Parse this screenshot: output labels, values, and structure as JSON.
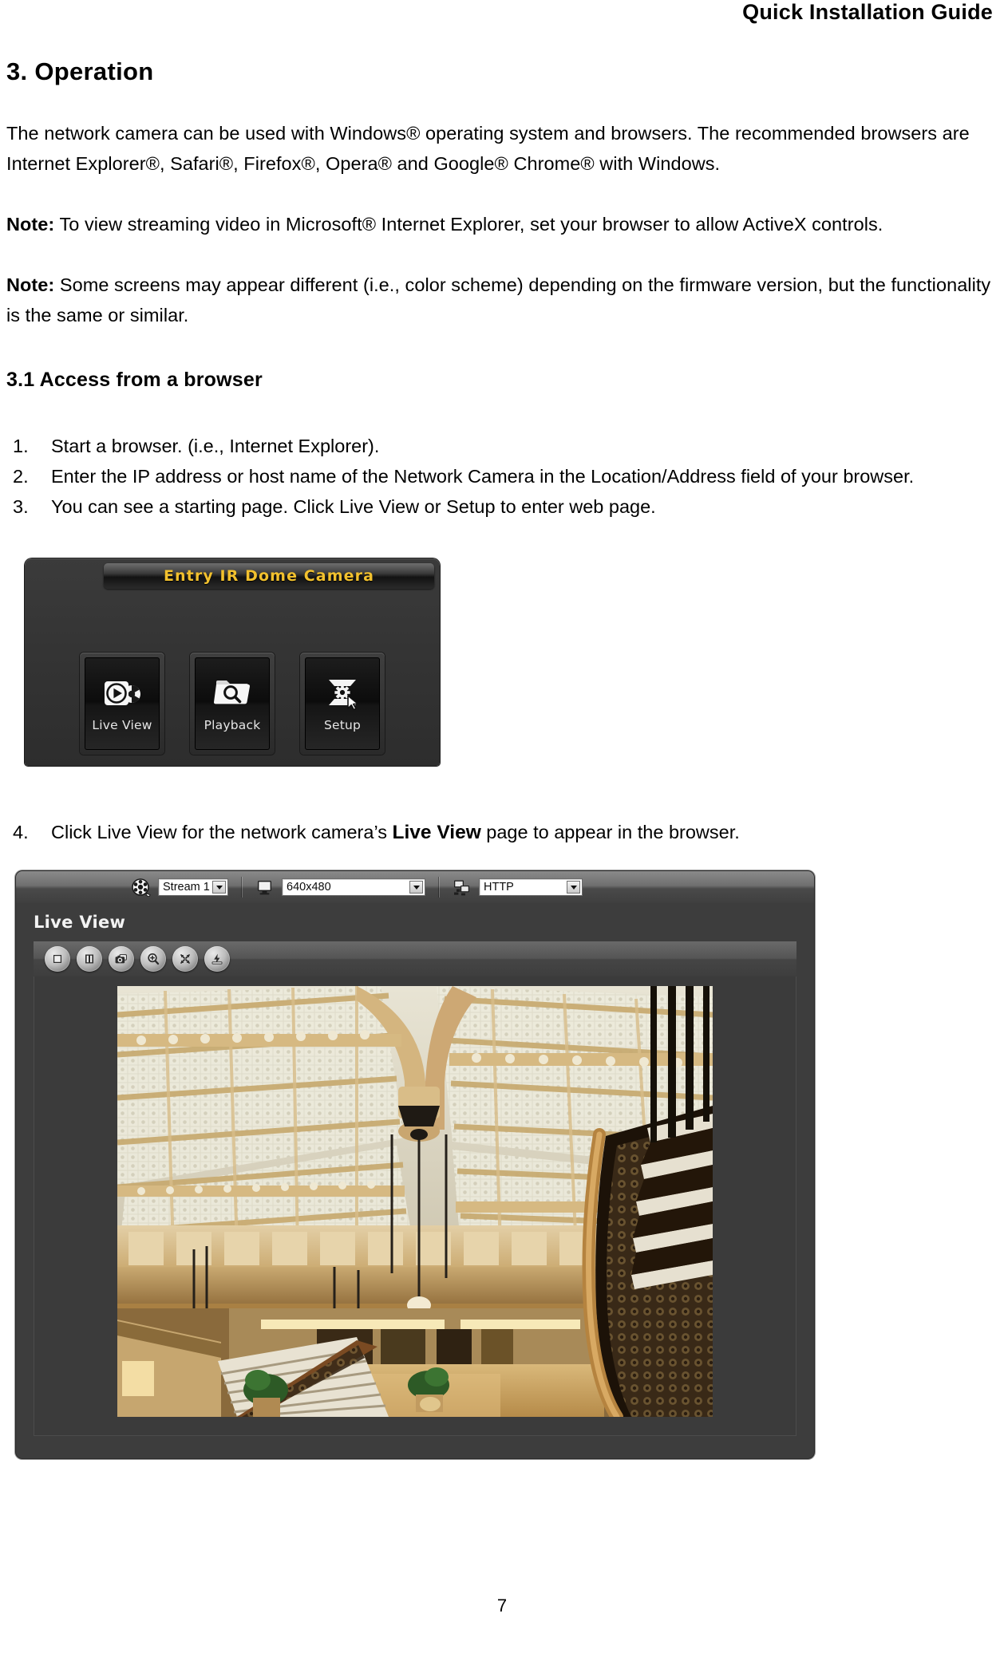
{
  "document": {
    "header_title": "Quick Installation Guide",
    "page_number": "7"
  },
  "section": {
    "number_title": "3. Operation",
    "intro_paragraph": "The network camera can be used with Windows® operating system and browsers. The recommended browsers are Internet Explorer®, Safari®, Firefox®, Opera® and Google® Chrome® with Windows.",
    "note1_label": "Note:",
    "note1_text": " To view streaming video in Microsoft® Internet Explorer, set your browser to allow ActiveX controls.",
    "note2_label": "Note:",
    "note2_text": " Some screens may appear different (i.e., color scheme) depending on the firmware version, but the functionality is the same or similar.",
    "subsection_title": "3.1 Access from a browser"
  },
  "steps": [
    {
      "num": "1.",
      "text": "Start a browser. (i.e., Internet Explorer)."
    },
    {
      "num": "2.",
      "text": "Enter the IP address or host name of the Network Camera in the Location/Address field of your browser."
    },
    {
      "num": "3.",
      "text": "You can see a starting page. Click Live View or Setup to enter web page."
    }
  ],
  "step4": {
    "num": "4.",
    "text_before": "Click Live View for the network camera’s ",
    "bold": "Live View",
    "text_after": " page to appear in the browser."
  },
  "start_page": {
    "title": "Entry IR Dome Camera",
    "title_color": "#f2c12e",
    "buttons": [
      {
        "label": "Live View",
        "icon": "play-film-icon"
      },
      {
        "label": "Playback",
        "icon": "folder-search-icon"
      },
      {
        "label": "Setup",
        "icon": "gear-cursor-icon"
      }
    ]
  },
  "live_view": {
    "panel_title": "Live View",
    "toolbar": {
      "stream": {
        "icon": "film-reel-icon",
        "value": "Stream 1"
      },
      "resolution": {
        "icon": "monitor-icon",
        "value": "640x480"
      },
      "protocol": {
        "icon": "network-icon",
        "value": "HTTP"
      }
    },
    "controls": [
      {
        "name": "stop-button",
        "icon": "stop-icon"
      },
      {
        "name": "pause-button",
        "icon": "pause-icon"
      },
      {
        "name": "snapshot-button",
        "icon": "camera-icon"
      },
      {
        "name": "zoom-button",
        "icon": "magnifier-plus-icon"
      },
      {
        "name": "fullscreen-button",
        "icon": "expand-arrows-icon"
      },
      {
        "name": "record-button",
        "icon": "record-icon"
      }
    ],
    "video_alt": "Rookery Building atrium interior with glass roof and curved staircase"
  }
}
